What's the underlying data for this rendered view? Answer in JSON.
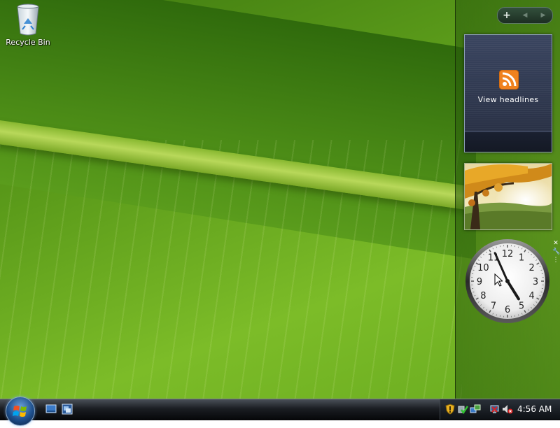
{
  "desktop": {
    "wallpaper": "green-leaf",
    "icons": [
      {
        "label": "Recycle Bin",
        "icon": "recycle-bin-icon"
      }
    ]
  },
  "sidebar": {
    "controls": {
      "add_label": "+",
      "prev_label": "◀",
      "next_label": "▶"
    },
    "feed_gadget": {
      "icon": "rss-icon",
      "label": "View headlines",
      "accent": "#f0821e"
    },
    "slideshow_gadget": {
      "image": "autumn-tree-landscape"
    },
    "clock_gadget": {
      "numbers": [
        "12",
        "1",
        "2",
        "3",
        "4",
        "5",
        "6",
        "7",
        "8",
        "9",
        "10",
        "11"
      ],
      "time": {
        "hour": 4,
        "minute": 56
      },
      "tool_close": "✕",
      "tool_options": "🔧",
      "tool_drag": "⋮"
    }
  },
  "taskbar": {
    "start": "start-orb",
    "quick_launch": [
      "show-desktop-icon",
      "switch-windows-icon"
    ],
    "tray_icons": [
      "security-shield-icon",
      "windows-defender-icon",
      "network-icon",
      "network-disconnected-icon",
      "volume-muted-icon"
    ],
    "clock": "4:56 AM"
  }
}
